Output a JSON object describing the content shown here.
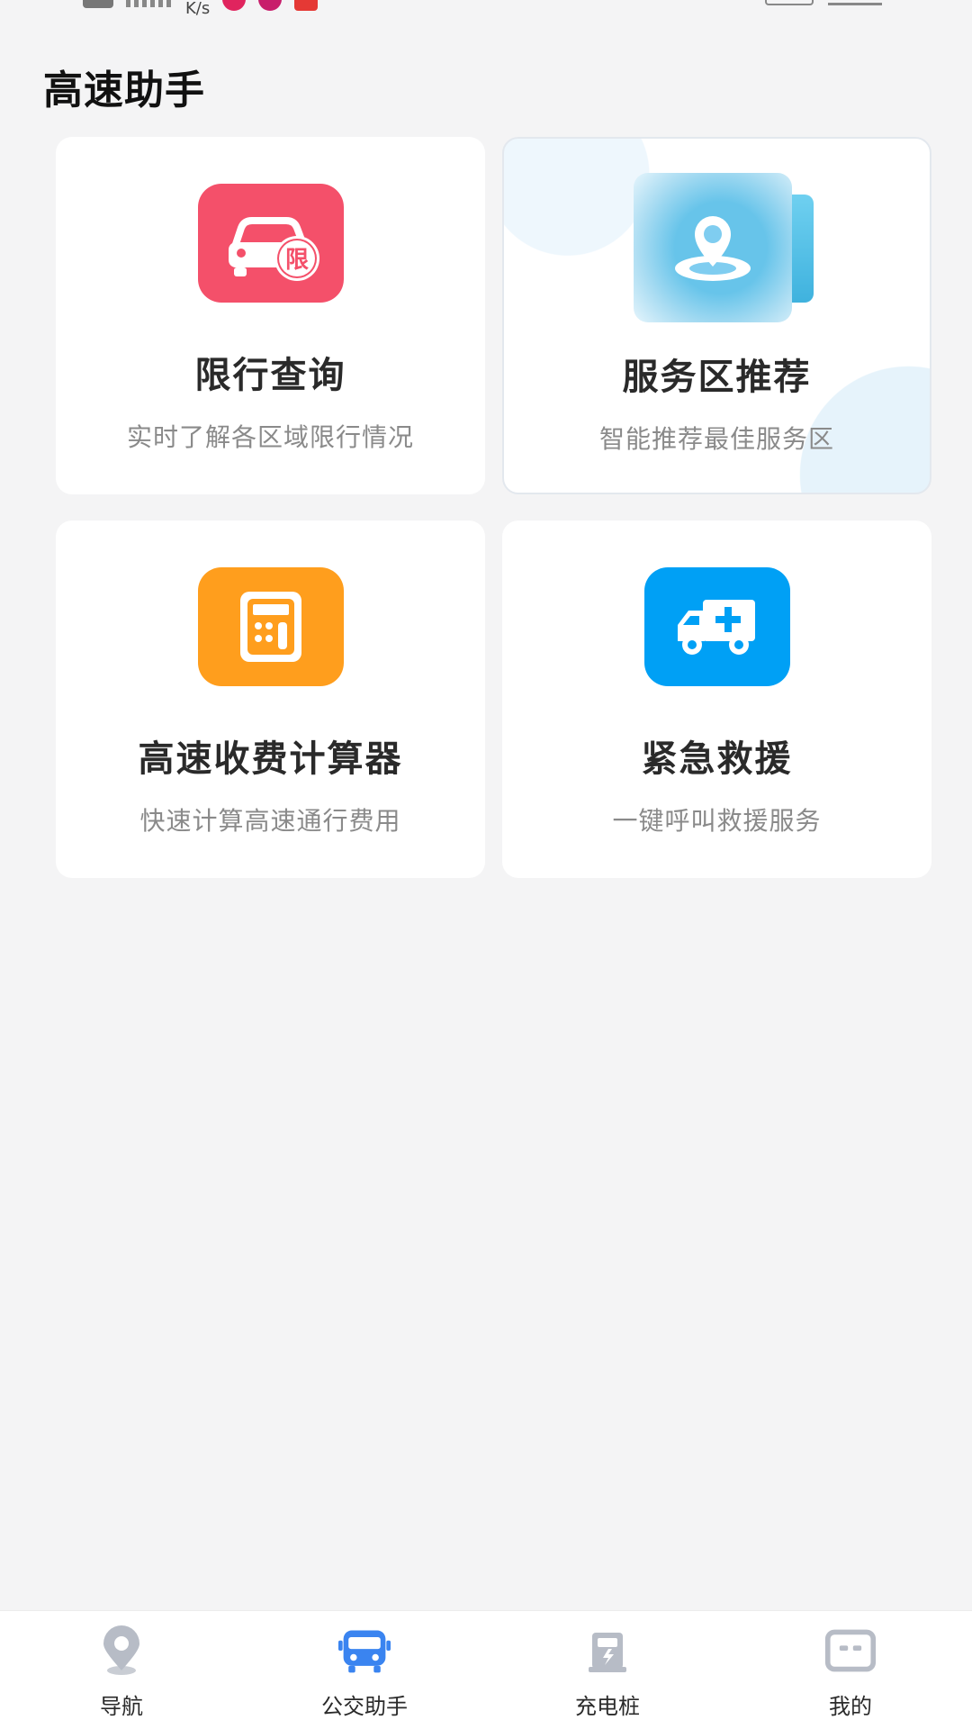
{
  "status_bar": {
    "net_speed_unit": "K/s"
  },
  "page": {
    "title": "高速助手"
  },
  "cards": [
    {
      "title": "限行查询",
      "subtitle": "实时了解各区域限行情况",
      "icon": "car-restriction-icon",
      "badge": "限",
      "color": "#f4506a"
    },
    {
      "title": "服务区推荐",
      "subtitle": "智能推荐最佳服务区",
      "icon": "location-pin-icon",
      "color": "#3fb2de"
    },
    {
      "title": "高速收费计算器",
      "subtitle": "快速计算高速通行费用",
      "icon": "calculator-icon",
      "color": "#ff9e1d"
    },
    {
      "title": "紧急救援",
      "subtitle": "一键呼叫救援服务",
      "icon": "ambulance-icon",
      "color": "#00a0f5"
    }
  ],
  "tabbar": {
    "items": [
      {
        "label": "导航",
        "icon": "map-pin-icon",
        "active": false
      },
      {
        "label": "公交助手",
        "icon": "bus-icon",
        "active": true
      },
      {
        "label": "充电桩",
        "icon": "charging-station-icon",
        "active": false
      },
      {
        "label": "我的",
        "icon": "profile-face-icon",
        "active": false
      }
    ],
    "active_color": "#3a84f0",
    "inactive_color": "#b7bcc6"
  }
}
